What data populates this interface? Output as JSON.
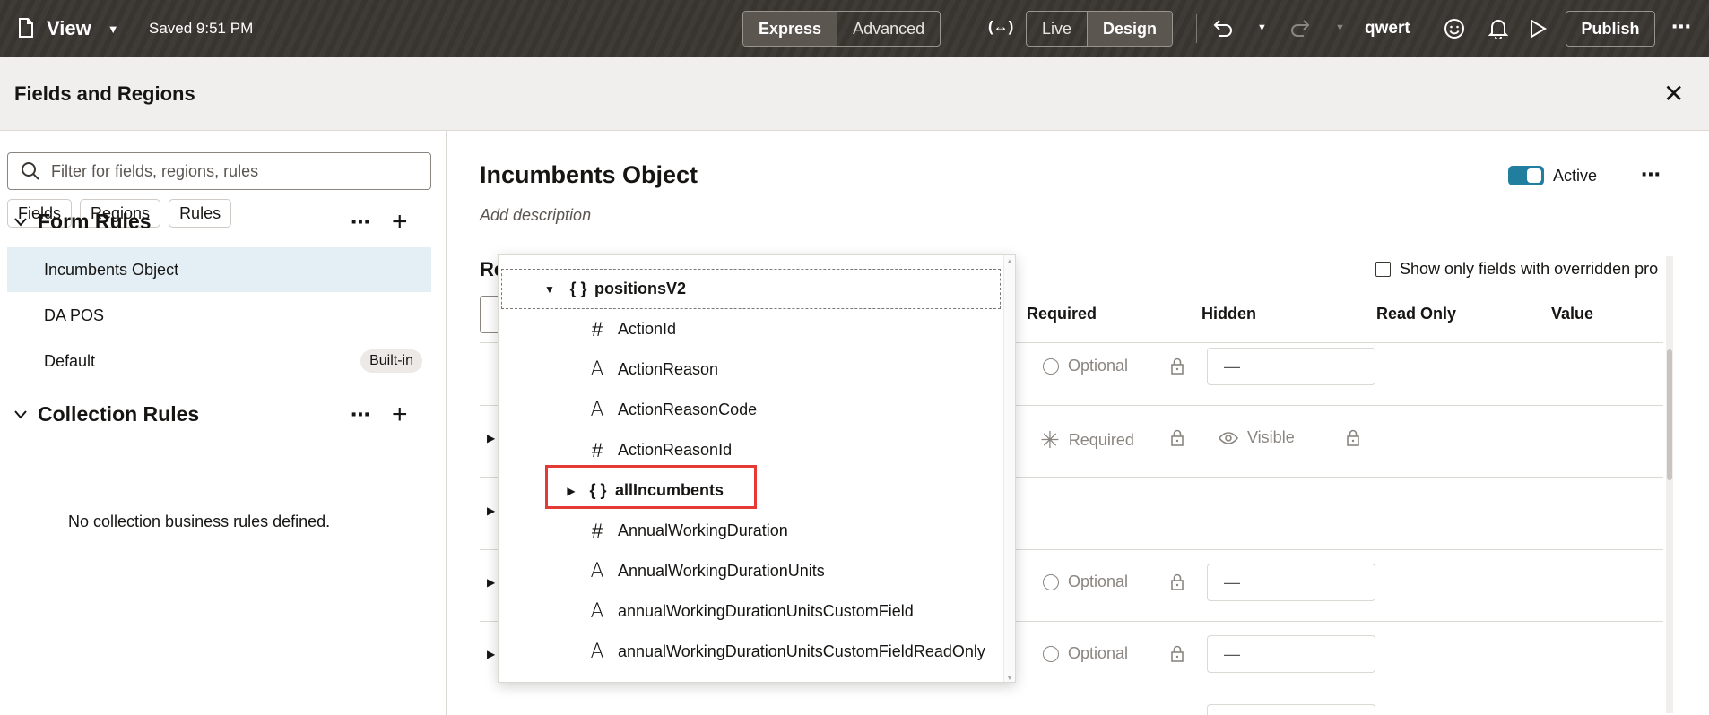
{
  "topbar": {
    "view_label": "View",
    "saved": "Saved 9:51 PM",
    "mode_express": "Express",
    "mode_advanced": "Advanced",
    "live": "Live",
    "design": "Design",
    "user": "qwert",
    "publish": "Publish"
  },
  "band": {
    "title": "Fields and Regions"
  },
  "left": {
    "search_placeholder": "Filter for fields, regions, rules",
    "chips": [
      "Fields",
      "Regions",
      "Rules"
    ],
    "form_rules_title": "Form Rules",
    "form_rules": [
      {
        "label": "Incumbents Object",
        "badge": ""
      },
      {
        "label": "DA POS",
        "badge": ""
      },
      {
        "label": "Default",
        "badge": "Built-in"
      }
    ],
    "collection_rules_title": "Collection Rules",
    "no_collection": "No collection business rules defined."
  },
  "main": {
    "title": "Incumbents Object",
    "description": "Add description",
    "active_label": "Active",
    "section_stub": "Re",
    "show_only": "Show only fields with overridden pro",
    "columns": {
      "required": "Required",
      "hidden": "Hidden",
      "readonly": "Read Only",
      "value": "Value"
    },
    "rows": [
      {
        "required": "Optional",
        "hidden": "",
        "value": "—"
      },
      {
        "required": "Required",
        "hidden": "Visible",
        "value": ""
      },
      {
        "required": "",
        "hidden": "",
        "value": ""
      },
      {
        "required": "Optional",
        "hidden": "",
        "value": "—"
      },
      {
        "required": "Optional",
        "hidden": "",
        "value": "—"
      }
    ]
  },
  "dropdown": {
    "root": "positionsV2",
    "items": [
      {
        "icon": "#",
        "label": "ActionId"
      },
      {
        "icon": "A",
        "label": "ActionReason"
      },
      {
        "icon": "A",
        "label": "ActionReasonCode"
      },
      {
        "icon": "#",
        "label": "ActionReasonId"
      },
      {
        "icon": "{ }",
        "label": "allIncumbents"
      },
      {
        "icon": "#",
        "label": "AnnualWorkingDuration"
      },
      {
        "icon": "A",
        "label": "AnnualWorkingDurationUnits"
      },
      {
        "icon": "A",
        "label": "annualWorkingDurationUnitsCustomField"
      },
      {
        "icon": "A",
        "label": "annualWorkingDurationUnitsCustomFieldReadOnly"
      }
    ]
  },
  "colors": {
    "topbar": "#3a3632",
    "accent": "#227e9e",
    "selected": "#e4eef5",
    "highlight": "#e53935"
  }
}
